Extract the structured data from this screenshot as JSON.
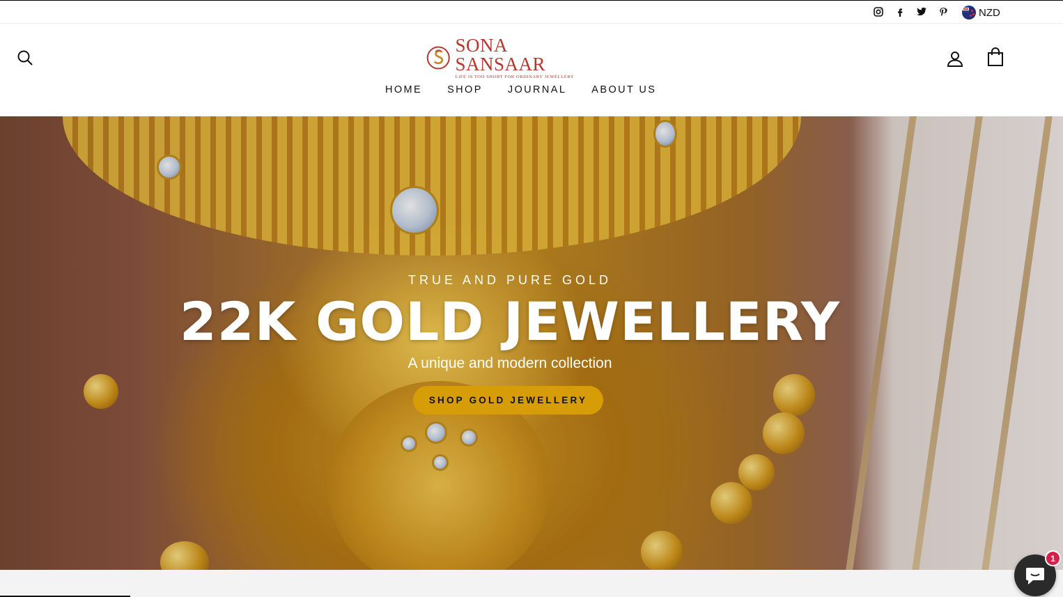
{
  "topbar": {
    "social": [
      "instagram-icon",
      "facebook-icon",
      "twitter-icon",
      "pinterest-icon"
    ],
    "currency": "NZD",
    "flag_icon": "new-zealand-flag-icon"
  },
  "header": {
    "logo_name": "SONA SANSAAR",
    "logo_tagline": "LIFE IS TOO SHORT FOR ORDINARY JEWELLERY",
    "nav": [
      "HOME",
      "SHOP",
      "JOURNAL",
      "ABOUT US"
    ],
    "icons": [
      "search-icon",
      "account-icon",
      "cart-icon"
    ]
  },
  "hero": {
    "subtitle": "TRUE AND PURE GOLD",
    "title": "22K GOLD JEWELLERY",
    "description": "A unique and modern collection",
    "cta": "SHOP GOLD JEWELLERY"
  },
  "chat": {
    "badge": "1",
    "icon": "chat-icon"
  },
  "colors": {
    "cta_bg": "#d79d06",
    "logo_red": "#b2392f",
    "badge": "#d6214a"
  }
}
